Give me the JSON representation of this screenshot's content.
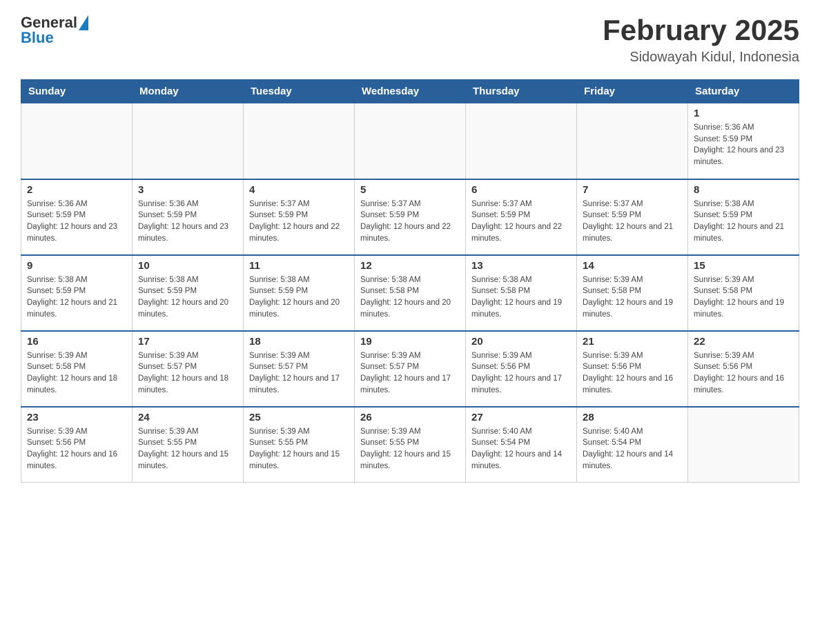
{
  "logo": {
    "text_general": "General",
    "text_blue": "Blue"
  },
  "title": "February 2025",
  "subtitle": "Sidowayah Kidul, Indonesia",
  "weekdays": [
    "Sunday",
    "Monday",
    "Tuesday",
    "Wednesday",
    "Thursday",
    "Friday",
    "Saturday"
  ],
  "weeks": [
    [
      null,
      null,
      null,
      null,
      null,
      null,
      {
        "num": "1",
        "sunrise": "Sunrise: 5:36 AM",
        "sunset": "Sunset: 5:59 PM",
        "daylight": "Daylight: 12 hours and 23 minutes."
      }
    ],
    [
      {
        "num": "2",
        "sunrise": "Sunrise: 5:36 AM",
        "sunset": "Sunset: 5:59 PM",
        "daylight": "Daylight: 12 hours and 23 minutes."
      },
      {
        "num": "3",
        "sunrise": "Sunrise: 5:36 AM",
        "sunset": "Sunset: 5:59 PM",
        "daylight": "Daylight: 12 hours and 23 minutes."
      },
      {
        "num": "4",
        "sunrise": "Sunrise: 5:37 AM",
        "sunset": "Sunset: 5:59 PM",
        "daylight": "Daylight: 12 hours and 22 minutes."
      },
      {
        "num": "5",
        "sunrise": "Sunrise: 5:37 AM",
        "sunset": "Sunset: 5:59 PM",
        "daylight": "Daylight: 12 hours and 22 minutes."
      },
      {
        "num": "6",
        "sunrise": "Sunrise: 5:37 AM",
        "sunset": "Sunset: 5:59 PM",
        "daylight": "Daylight: 12 hours and 22 minutes."
      },
      {
        "num": "7",
        "sunrise": "Sunrise: 5:37 AM",
        "sunset": "Sunset: 5:59 PM",
        "daylight": "Daylight: 12 hours and 21 minutes."
      },
      {
        "num": "8",
        "sunrise": "Sunrise: 5:38 AM",
        "sunset": "Sunset: 5:59 PM",
        "daylight": "Daylight: 12 hours and 21 minutes."
      }
    ],
    [
      {
        "num": "9",
        "sunrise": "Sunrise: 5:38 AM",
        "sunset": "Sunset: 5:59 PM",
        "daylight": "Daylight: 12 hours and 21 minutes."
      },
      {
        "num": "10",
        "sunrise": "Sunrise: 5:38 AM",
        "sunset": "Sunset: 5:59 PM",
        "daylight": "Daylight: 12 hours and 20 minutes."
      },
      {
        "num": "11",
        "sunrise": "Sunrise: 5:38 AM",
        "sunset": "Sunset: 5:59 PM",
        "daylight": "Daylight: 12 hours and 20 minutes."
      },
      {
        "num": "12",
        "sunrise": "Sunrise: 5:38 AM",
        "sunset": "Sunset: 5:58 PM",
        "daylight": "Daylight: 12 hours and 20 minutes."
      },
      {
        "num": "13",
        "sunrise": "Sunrise: 5:38 AM",
        "sunset": "Sunset: 5:58 PM",
        "daylight": "Daylight: 12 hours and 19 minutes."
      },
      {
        "num": "14",
        "sunrise": "Sunrise: 5:39 AM",
        "sunset": "Sunset: 5:58 PM",
        "daylight": "Daylight: 12 hours and 19 minutes."
      },
      {
        "num": "15",
        "sunrise": "Sunrise: 5:39 AM",
        "sunset": "Sunset: 5:58 PM",
        "daylight": "Daylight: 12 hours and 19 minutes."
      }
    ],
    [
      {
        "num": "16",
        "sunrise": "Sunrise: 5:39 AM",
        "sunset": "Sunset: 5:58 PM",
        "daylight": "Daylight: 12 hours and 18 minutes."
      },
      {
        "num": "17",
        "sunrise": "Sunrise: 5:39 AM",
        "sunset": "Sunset: 5:57 PM",
        "daylight": "Daylight: 12 hours and 18 minutes."
      },
      {
        "num": "18",
        "sunrise": "Sunrise: 5:39 AM",
        "sunset": "Sunset: 5:57 PM",
        "daylight": "Daylight: 12 hours and 17 minutes."
      },
      {
        "num": "19",
        "sunrise": "Sunrise: 5:39 AM",
        "sunset": "Sunset: 5:57 PM",
        "daylight": "Daylight: 12 hours and 17 minutes."
      },
      {
        "num": "20",
        "sunrise": "Sunrise: 5:39 AM",
        "sunset": "Sunset: 5:56 PM",
        "daylight": "Daylight: 12 hours and 17 minutes."
      },
      {
        "num": "21",
        "sunrise": "Sunrise: 5:39 AM",
        "sunset": "Sunset: 5:56 PM",
        "daylight": "Daylight: 12 hours and 16 minutes."
      },
      {
        "num": "22",
        "sunrise": "Sunrise: 5:39 AM",
        "sunset": "Sunset: 5:56 PM",
        "daylight": "Daylight: 12 hours and 16 minutes."
      }
    ],
    [
      {
        "num": "23",
        "sunrise": "Sunrise: 5:39 AM",
        "sunset": "Sunset: 5:56 PM",
        "daylight": "Daylight: 12 hours and 16 minutes."
      },
      {
        "num": "24",
        "sunrise": "Sunrise: 5:39 AM",
        "sunset": "Sunset: 5:55 PM",
        "daylight": "Daylight: 12 hours and 15 minutes."
      },
      {
        "num": "25",
        "sunrise": "Sunrise: 5:39 AM",
        "sunset": "Sunset: 5:55 PM",
        "daylight": "Daylight: 12 hours and 15 minutes."
      },
      {
        "num": "26",
        "sunrise": "Sunrise: 5:39 AM",
        "sunset": "Sunset: 5:55 PM",
        "daylight": "Daylight: 12 hours and 15 minutes."
      },
      {
        "num": "27",
        "sunrise": "Sunrise: 5:40 AM",
        "sunset": "Sunset: 5:54 PM",
        "daylight": "Daylight: 12 hours and 14 minutes."
      },
      {
        "num": "28",
        "sunrise": "Sunrise: 5:40 AM",
        "sunset": "Sunset: 5:54 PM",
        "daylight": "Daylight: 12 hours and 14 minutes."
      },
      null
    ]
  ]
}
